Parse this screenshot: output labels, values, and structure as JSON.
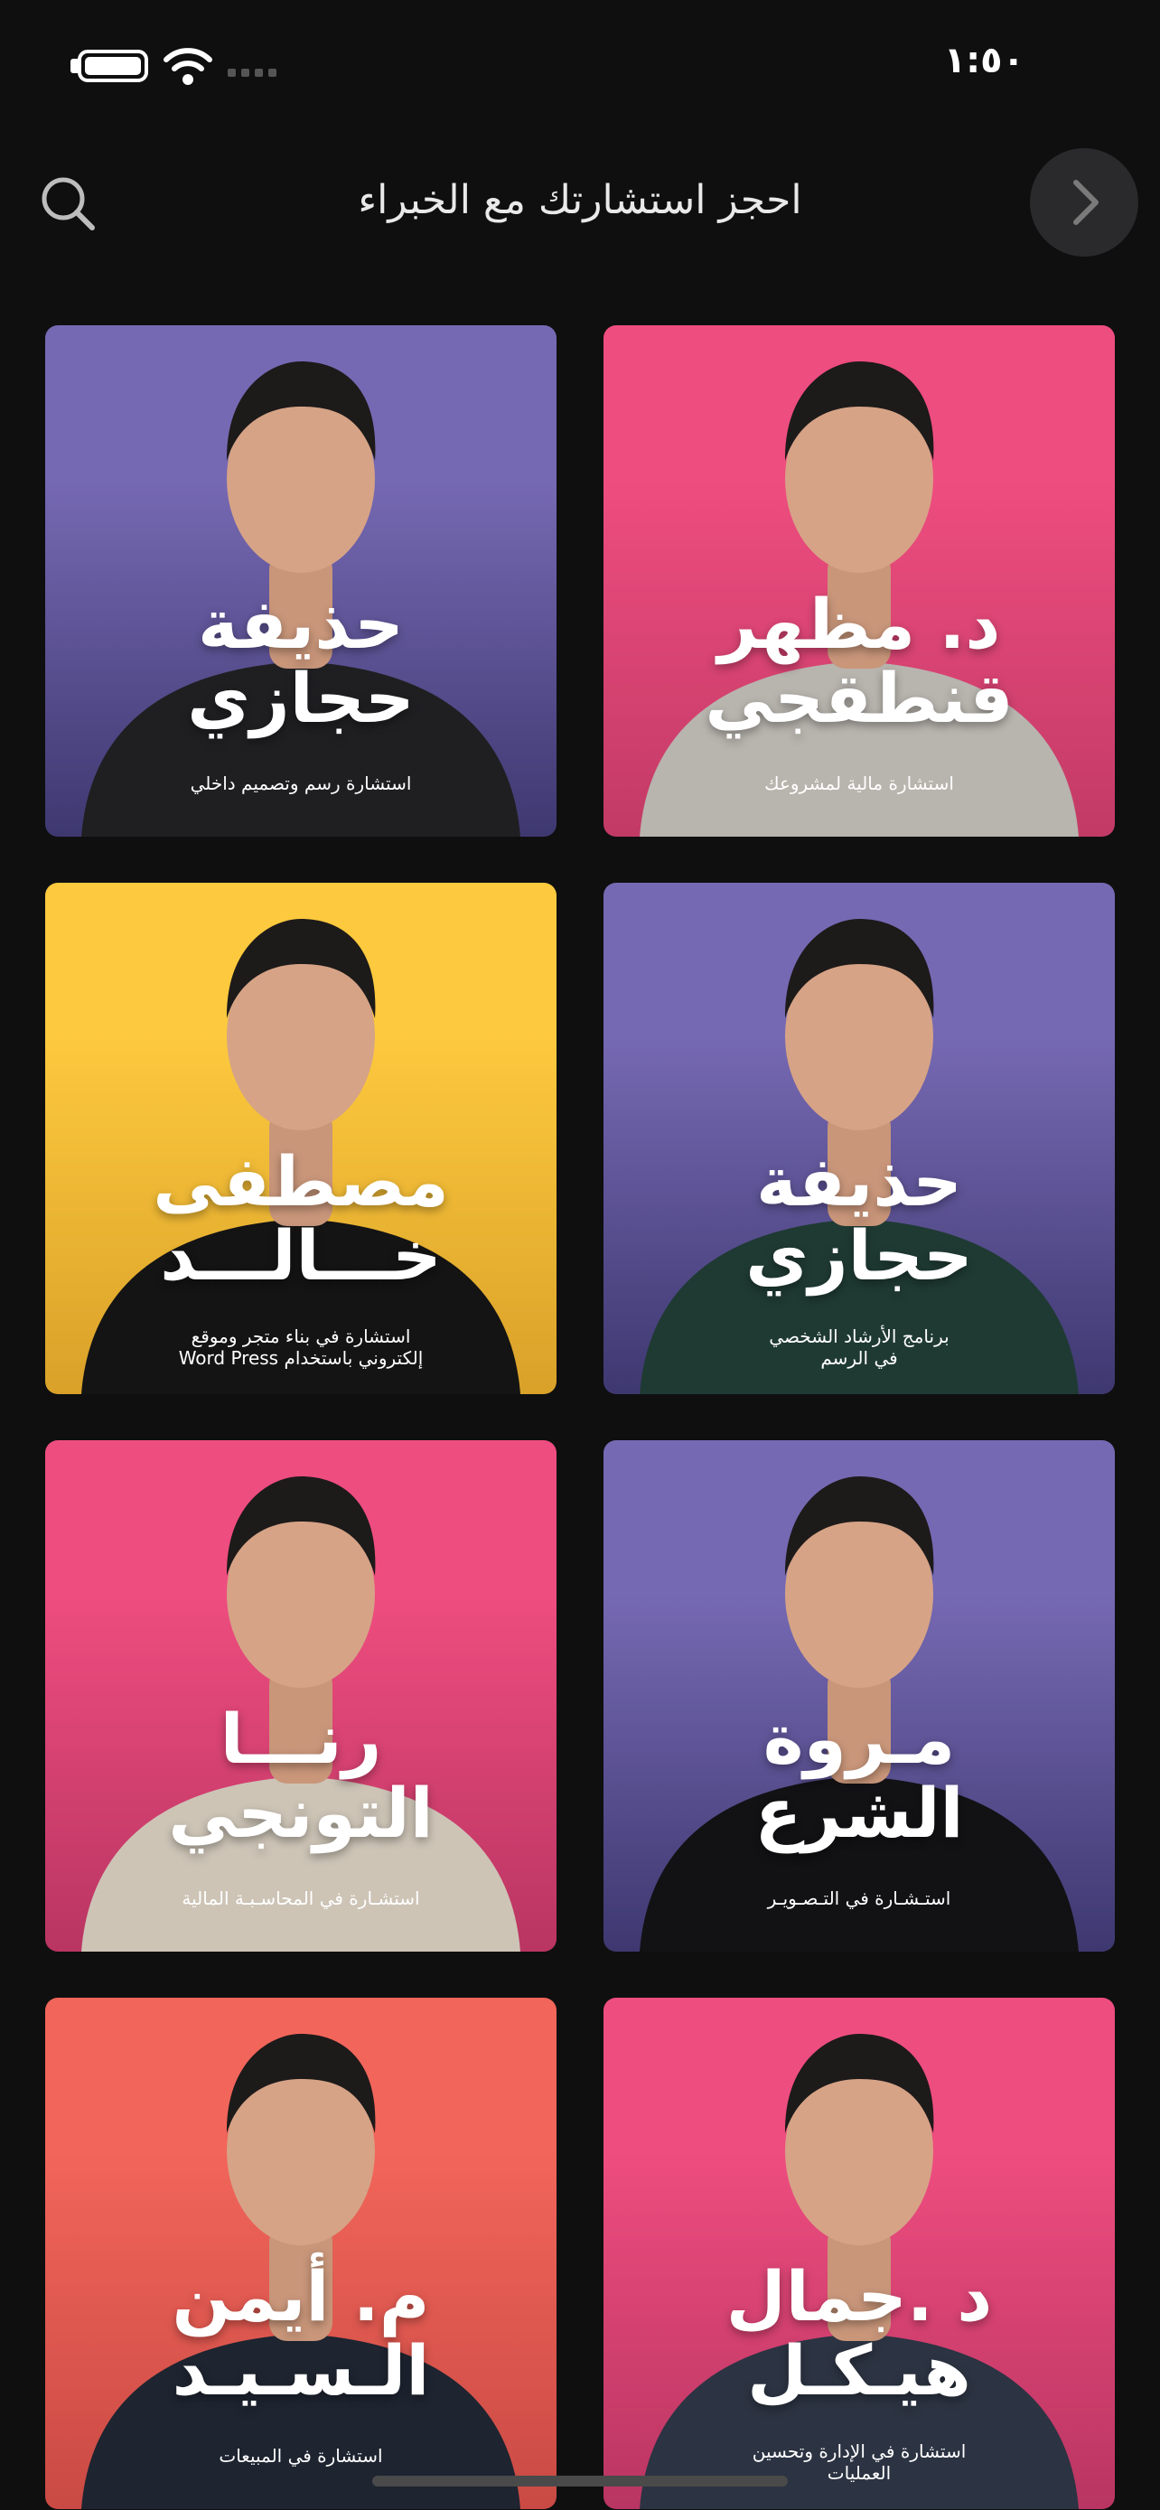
{
  "status_bar": {
    "time": "١:٥٠"
  },
  "header": {
    "title": "احجز استشارتك مع الخبراء"
  },
  "cards": [
    {
      "name_line1": "د. مظهر",
      "name_line2": "قنطقجي",
      "subtitle_line1": "استشارة مالية لمشروعك",
      "subtitle_line2": "",
      "bg_top": "#ee4d7f",
      "bg_bottom": "#c23a66",
      "suit": "#b8b4ae"
    },
    {
      "name_line1": "حذيفة",
      "name_line2": "حجازي",
      "subtitle_line1": "استشارة رسم وتصميم داخلي",
      "subtitle_line2": "",
      "bg_top": "#7669b3",
      "bg_bottom": "#3e3870",
      "suit": "#1f1f22"
    },
    {
      "name_line1": "حذيفة",
      "name_line2": "حجازي",
      "subtitle_line1": "برنامج الأرشاد الشخصي",
      "subtitle_line2": "في الرسم",
      "bg_top": "#7669b3",
      "bg_bottom": "#3e3870",
      "suit": "#1f3a33"
    },
    {
      "name_line1": "مصطفى",
      "name_line2": "خـــالـــد",
      "subtitle_line1": "استشارة في بناء متجر وموقع",
      "subtitle_line2": "إلكتروني باستخدام Word Press",
      "bg_top": "#fdc93e",
      "bg_bottom": "#d9a129",
      "suit": "#141414"
    },
    {
      "name_line1": "مـروة",
      "name_line2": "الشرع",
      "subtitle_line1": "استـشـارة في التـصـويـر",
      "subtitle_line2": "",
      "bg_top": "#7669b3",
      "bg_bottom": "#3e3870",
      "suit": "#121215"
    },
    {
      "name_line1": "رنـــا",
      "name_line2": "التونجي",
      "subtitle_line1": "استشـارة في المحاسـبـة المالية",
      "subtitle_line2": "",
      "bg_top": "#ee4d7f",
      "bg_bottom": "#b93562",
      "suit": "#cdc4b6"
    },
    {
      "name_line1": "د .جمال",
      "name_line2": "هيـكـل",
      "subtitle_line1": "استشارة في الإدارة وتحسين",
      "subtitle_line2": "العمليات",
      "bg_top": "#ee4d7f",
      "bg_bottom": "#b93562",
      "suit": "#2c3342"
    },
    {
      "name_line1": "م. أيمن",
      "name_line2": "الـسـيـد",
      "subtitle_line1": "استشارة في المبيعات",
      "subtitle_line2": "",
      "bg_top": "#f2655a",
      "bg_bottom": "#c94a44",
      "suit": "#1e2430"
    }
  ]
}
